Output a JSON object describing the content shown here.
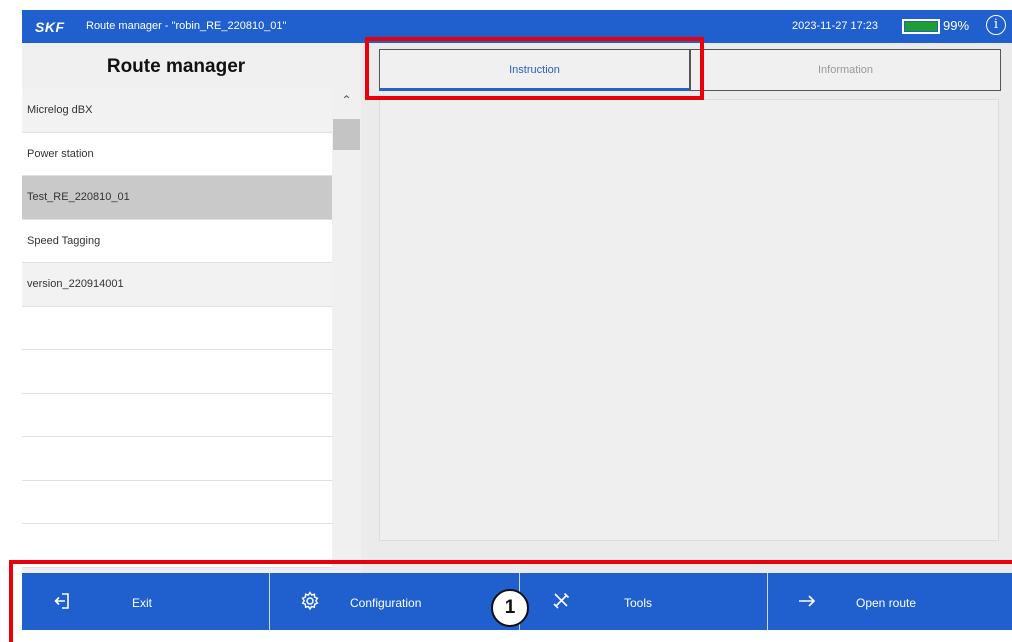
{
  "titlebar": {
    "logo": "SKF",
    "title": "Route manager - \"robin_RE_220810_01\"",
    "datetime": "2023-11-27 17:23",
    "battery_level": 0.99,
    "battery_text": "99%",
    "battery_color": "#1e9e32"
  },
  "left": {
    "header": "Route manager",
    "routes": [
      "Micrelog dBX",
      "Power station",
      "Test_RE_220810_01",
      "Speed Tagging",
      "version_220914001"
    ],
    "selected_index": 2,
    "empty_rows": 6
  },
  "tabs": {
    "instruction": "Instruction",
    "information": "Information"
  },
  "bottom": {
    "exit": "Exit",
    "configuration": "Configuration",
    "tools": "Tools",
    "open_route": "Open route"
  },
  "annotation": {
    "callout": "1"
  },
  "colors": {
    "brand_blue": "#1f5fce",
    "highlight_red": "#e8000b",
    "selected_row": "#c9c9c9"
  },
  "icons": {
    "exit": "exit-icon",
    "configuration": "gear-icon",
    "tools": "tools-icon",
    "open_route": "arrow-right-icon",
    "info": "info-icon"
  }
}
